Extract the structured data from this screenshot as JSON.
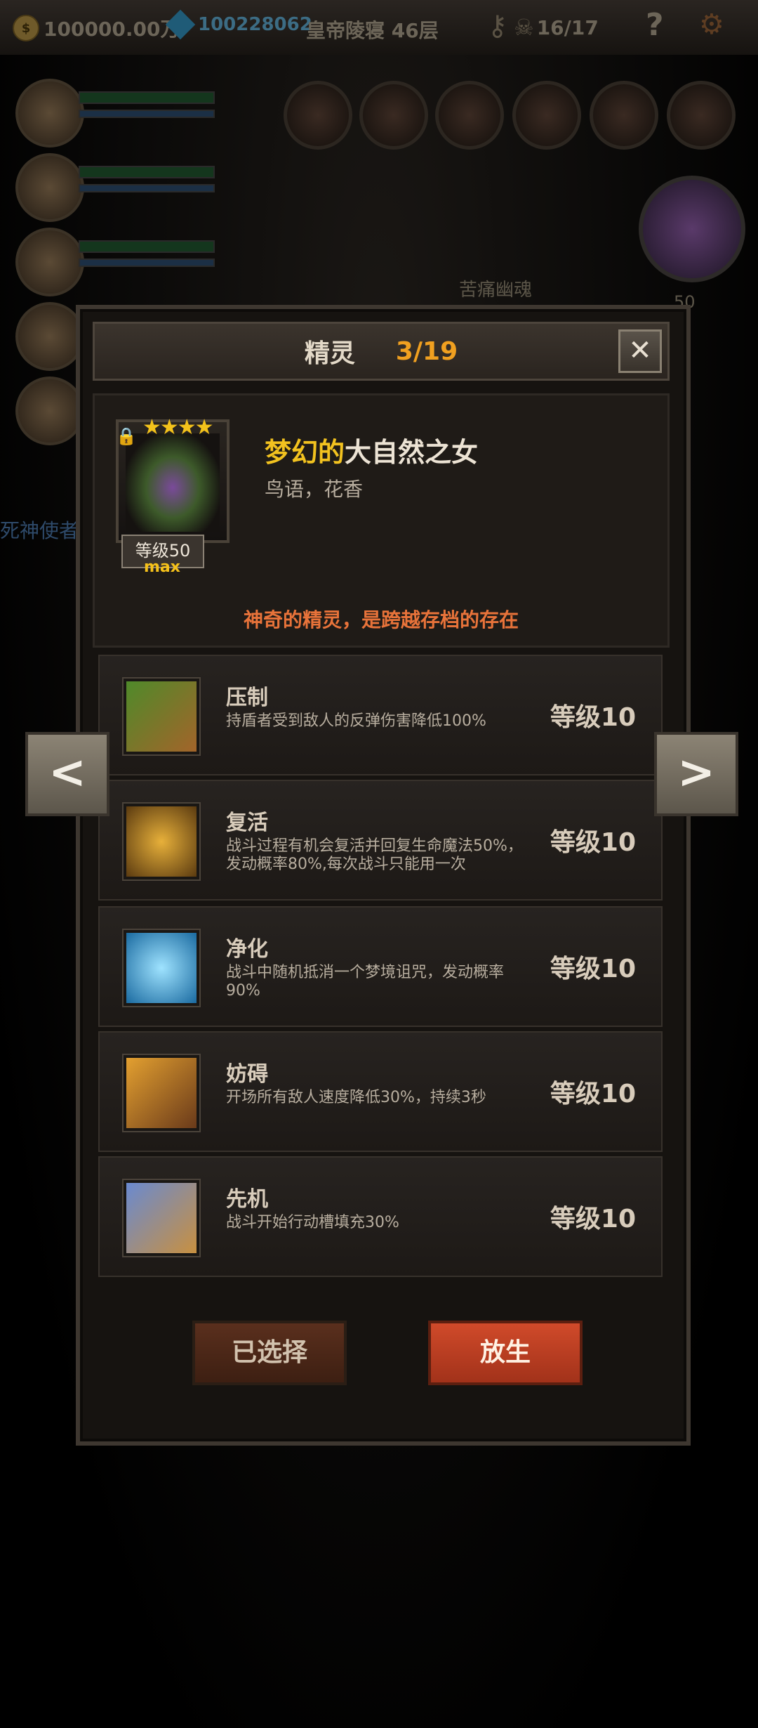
{
  "topbar": {
    "gold": "100000.00万",
    "gems": "100228062",
    "floor": "皇帝陵寝 46层",
    "keys_icon": "key-icon",
    "monsters": "16/17",
    "help": "?"
  },
  "scene": {
    "boss_name": "苦痛幽魂",
    "boss_level": "50",
    "left_label": "死神使者"
  },
  "dialog": {
    "title": "精灵",
    "count": "3/19",
    "close": "✕"
  },
  "spirit": {
    "stars": "★★★★",
    "level": "等级50",
    "max": "max",
    "name_prefix": "梦幻的",
    "name": "大自然之女",
    "subtitle": "鸟语，花香",
    "description": "神奇的精灵，是跨越存档的存在"
  },
  "skills": [
    {
      "name": "压制",
      "desc": "持盾者受到敌人的反弹伤害降低100%",
      "level": "等级10",
      "icon": "claw-icon"
    },
    {
      "name": "复活",
      "desc": "战斗过程有机会复活并回复生命魔法50%，发动概率80%,每次战斗只能用一次",
      "level": "等级10",
      "icon": "revive-icon"
    },
    {
      "name": "净化",
      "desc": "战斗中随机抵消一个梦境诅咒，发动概率90%",
      "level": "等级10",
      "icon": "flower-icon"
    },
    {
      "name": "妨碍",
      "desc": "开场所有敌人速度降低30%，持续3秒",
      "level": "等级10",
      "icon": "shackle-icon"
    },
    {
      "name": "先机",
      "desc": "战斗开始行动槽填充30%",
      "level": "等级10",
      "icon": "leopard-icon"
    }
  ],
  "buttons": {
    "selected": "已选择",
    "release": "放生",
    "prev": "<",
    "next": ">"
  },
  "colors": {
    "accent_gold": "#f2c21f",
    "count_orange": "#f0a020",
    "desc_orange": "#e8733a",
    "release_red": "#c0402a"
  }
}
